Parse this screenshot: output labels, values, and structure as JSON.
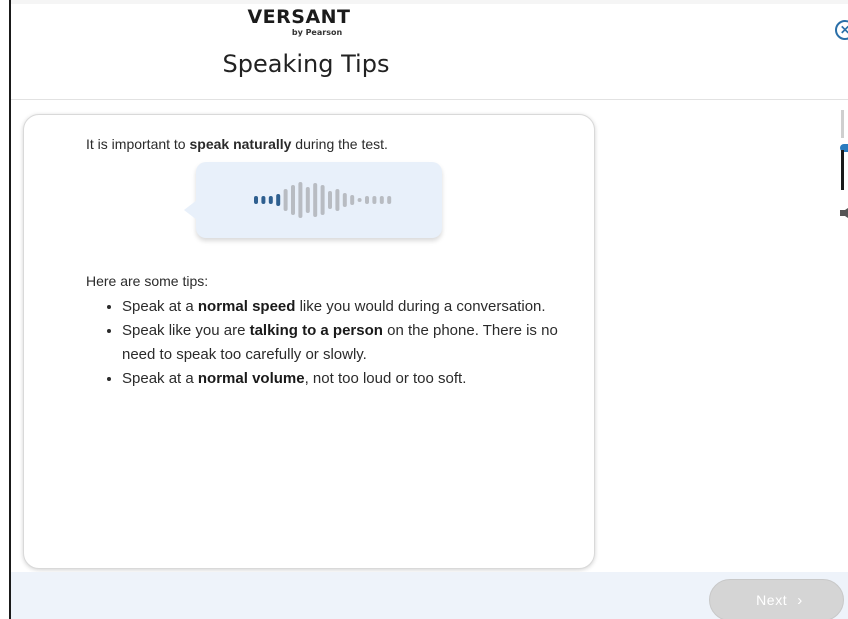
{
  "header": {
    "logo_main": "VERSANT",
    "logo_sub": "by Pearson",
    "title": "Speaking Tips",
    "close_icon": "close-circle-icon"
  },
  "card": {
    "intro": {
      "before": "It is important to ",
      "bold": "speak naturally",
      "after": " during the test."
    },
    "tips_heading": "Here are some tips:",
    "tips": [
      {
        "before": "Speak at a ",
        "bold": "normal speed",
        "after": " like you would during a conversation."
      },
      {
        "before": "Speak like you are ",
        "bold": "talking to a person",
        "after": " on the phone. There is no need to speak too carefully or slowly."
      },
      {
        "before": "Speak at a ",
        "bold": "normal volume",
        "after": ", not too loud or too soft."
      }
    ]
  },
  "waveform_icon": "audio-waveform-icon",
  "colors": {
    "wave_active": "#2e5f8f",
    "wave_inactive": "#b8bcc2",
    "bubble_bg": "#e8f0fa",
    "accent": "#2a6fa8",
    "footer_bg": "#eef3fa"
  },
  "footer": {
    "next_label": "Next",
    "next_icon": "chevron-right-icon"
  },
  "side_controls": {
    "mic_icon": "mic-level-slider",
    "speaker_icon": "speaker-icon"
  }
}
